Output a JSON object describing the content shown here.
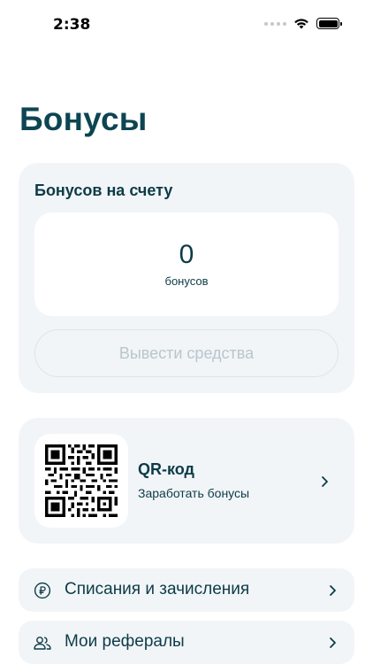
{
  "status_bar": {
    "time": "2:38"
  },
  "page": {
    "title": "Бонусы"
  },
  "bonus_card": {
    "title": "Бонусов на счету",
    "value": "0",
    "unit": "бонусов",
    "withdraw_label": "Вывести средства"
  },
  "qr_card": {
    "title": "QR-код",
    "subtitle": "Заработать бонусы",
    "icon": "qr-code-icon"
  },
  "menu": {
    "items": [
      {
        "label": "Списания и зачисления",
        "icon": "ruble-coin-icon"
      },
      {
        "label": "Мои рефералы",
        "icon": "users-icon"
      }
    ]
  },
  "colors": {
    "title": "#0d4552",
    "text": "#0d3b47",
    "card_bg": "#f1f5f8",
    "disabled_text": "#bac6cc"
  }
}
